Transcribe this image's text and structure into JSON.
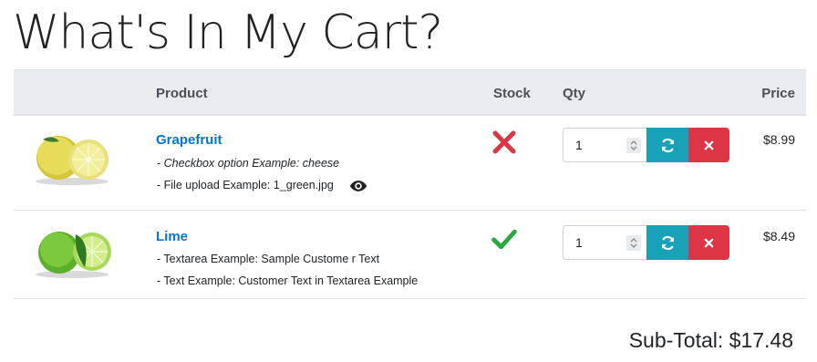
{
  "page": {
    "title": "What's In My Cart?"
  },
  "table": {
    "headers": {
      "product": "Product",
      "stock": "Stock",
      "qty": "Qty",
      "price": "Price"
    }
  },
  "items": [
    {
      "name": "Grapefruit",
      "options": [
        {
          "label": "- Checkbox option Example: cheese",
          "italic": true
        },
        {
          "label": "- File upload Example: 1_green.jpg",
          "italic": false
        }
      ],
      "in_stock": false,
      "stock_icon": "x-icon",
      "quantity": "1",
      "price": "$8.99",
      "image_icon": "grapefruit-image"
    },
    {
      "name": "Lime",
      "options": [
        {
          "label": "- Textarea Example: Sample Custome r Text",
          "italic": false
        },
        {
          "label": "- Text Example: Customer Text in Textarea Example",
          "italic": false
        }
      ],
      "in_stock": true,
      "stock_icon": "check-icon",
      "quantity": "1",
      "price": "$8.49",
      "image_icon": "lime-image"
    }
  ],
  "summary": {
    "subtotal": "Sub-Total: $17.48"
  },
  "colors": {
    "link": "#0275d8",
    "update_button": "#17a2b8",
    "remove_button": "#dc3545",
    "out_of_stock": "#dc3545",
    "in_stock": "#28a745",
    "header_bg": "#e9ecef"
  }
}
